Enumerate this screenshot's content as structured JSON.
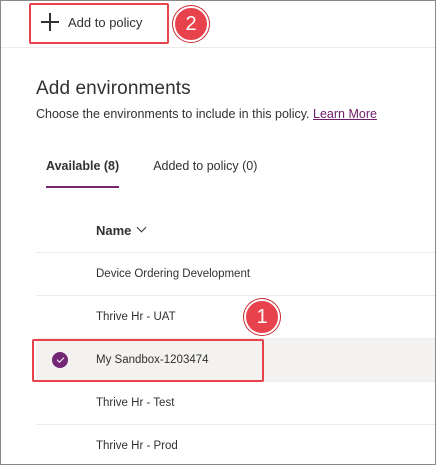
{
  "toolbar": {
    "add_label": "Add to policy"
  },
  "page": {
    "title": "Add environments",
    "description": "Choose the environments to include in this policy.",
    "learn_more": "Learn More"
  },
  "tabs": [
    {
      "label": "Available (8)",
      "active": true
    },
    {
      "label": "Added to policy (0)",
      "active": false
    }
  ],
  "table": {
    "header": "Name",
    "rows": [
      {
        "name": "Device Ordering Development",
        "selected": false
      },
      {
        "name": "Thrive Hr - UAT",
        "selected": false
      },
      {
        "name": "My Sandbox-1203474",
        "selected": true
      },
      {
        "name": "Thrive Hr - Test",
        "selected": false
      },
      {
        "name": "Thrive Hr - Prod",
        "selected": false
      }
    ]
  },
  "callouts": {
    "first": "1",
    "second": "2"
  },
  "colors": {
    "accent": "#742774",
    "callout": "#e8434c",
    "selected_row": "#f3f2f1",
    "link": "#6b1c6b"
  }
}
